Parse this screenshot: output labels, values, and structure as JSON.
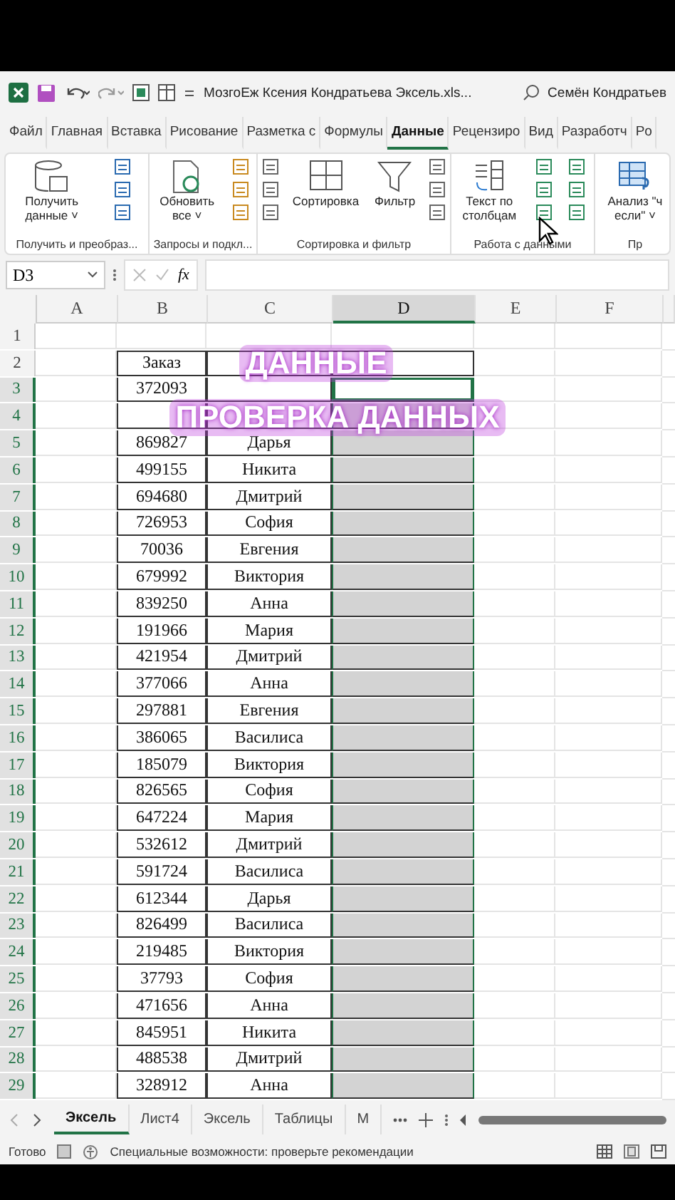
{
  "title_bar": {
    "title": "МозгоЕж Ксения Кондратьева Эксель.xls...",
    "user": "Семён Кондратьев"
  },
  "tabs": [
    {
      "label": "Файл",
      "selected": false
    },
    {
      "label": "Главная",
      "selected": false
    },
    {
      "label": "Вставка",
      "selected": false
    },
    {
      "label": "Рисование",
      "selected": false
    },
    {
      "label": "Разметка с",
      "selected": false
    },
    {
      "label": "Формулы",
      "selected": false
    },
    {
      "label": "Данные",
      "selected": true
    },
    {
      "label": "Рецензиро",
      "selected": false
    },
    {
      "label": "Вид",
      "selected": false
    },
    {
      "label": "Разработч",
      "selected": false
    },
    {
      "label": "Po",
      "selected": false
    }
  ],
  "ribbon_groups": [
    {
      "label": "Получить и преобраз...",
      "items": [
        {
          "kind": "large",
          "lines": [
            "Получить",
            "данные ˅"
          ]
        },
        {
          "kind": "small"
        }
      ]
    },
    {
      "label": "Запросы и подкл...",
      "items": [
        {
          "kind": "large",
          "lines": [
            "Обновить",
            "все ˅"
          ]
        },
        {
          "kind": "small"
        }
      ]
    },
    {
      "label": "Сортировка и фильтр",
      "items": [
        {
          "kind": "small"
        },
        {
          "kind": "large",
          "lines": [
            "Сортировка"
          ]
        },
        {
          "kind": "large",
          "lines": [
            "Фильтр"
          ]
        },
        {
          "kind": "small"
        }
      ]
    },
    {
      "label": "Работа с данными",
      "items": [
        {
          "kind": "large",
          "lines": [
            "Текст по",
            "столбцам"
          ]
        },
        {
          "kind": "small"
        },
        {
          "kind": "small"
        }
      ]
    },
    {
      "label": "Пр",
      "items": [
        {
          "kind": "large",
          "lines": [
            "Анализ \"ч",
            "если\" ˅"
          ]
        }
      ]
    }
  ],
  "formula_bar": {
    "name_box": "D3",
    "fx": "fx"
  },
  "columns": [
    {
      "label": "A",
      "selected": false
    },
    {
      "label": "B",
      "selected": false
    },
    {
      "label": "C",
      "selected": false
    },
    {
      "label": "D",
      "selected": true
    },
    {
      "label": "E",
      "selected": false
    },
    {
      "label": "F",
      "selected": false
    }
  ],
  "rows": [
    {
      "number": "1",
      "kind": "blank",
      "selected": false,
      "active": false
    },
    {
      "number": "2",
      "kind": "header",
      "selected": false,
      "active": false,
      "b": "Заказ"
    },
    {
      "number": "3",
      "kind": "data",
      "selected": true,
      "active": true,
      "b": "372093"
    },
    {
      "number": "4",
      "kind": "data",
      "selected": true,
      "active": false
    },
    {
      "number": "5",
      "kind": "data",
      "selected": true,
      "active": false,
      "b": "869827",
      "c": "Дарья"
    },
    {
      "number": "6",
      "kind": "data",
      "selected": true,
      "active": false,
      "b": "499155",
      "c": "Никита"
    },
    {
      "number": "7",
      "kind": "data",
      "selected": true,
      "active": false,
      "b": "694680",
      "c": "Дмитрий"
    },
    {
      "number": "8",
      "kind": "data",
      "selected": true,
      "active": false,
      "b": "726953",
      "c": "София"
    },
    {
      "number": "9",
      "kind": "data",
      "selected": true,
      "active": false,
      "b": "70036",
      "c": "Евгения"
    },
    {
      "number": "10",
      "kind": "data",
      "selected": true,
      "active": false,
      "b": "679992",
      "c": "Виктория"
    },
    {
      "number": "11",
      "kind": "data",
      "selected": true,
      "active": false,
      "b": "839250",
      "c": "Анна"
    },
    {
      "number": "12",
      "kind": "data",
      "selected": true,
      "active": false,
      "b": "191966",
      "c": "Мария"
    },
    {
      "number": "13",
      "kind": "data",
      "selected": true,
      "active": false,
      "b": "421954",
      "c": "Дмитрий"
    },
    {
      "number": "14",
      "kind": "data",
      "selected": true,
      "active": false,
      "b": "377066",
      "c": "Анна"
    },
    {
      "number": "15",
      "kind": "data",
      "selected": true,
      "active": false,
      "b": "297881",
      "c": "Евгения"
    },
    {
      "number": "16",
      "kind": "data",
      "selected": true,
      "active": false,
      "b": "386065",
      "c": "Василиса"
    },
    {
      "number": "17",
      "kind": "data",
      "selected": true,
      "active": false,
      "b": "185079",
      "c": "Виктория"
    },
    {
      "number": "18",
      "kind": "data",
      "selected": true,
      "active": false,
      "b": "826565",
      "c": "София"
    },
    {
      "number": "19",
      "kind": "data",
      "selected": true,
      "active": false,
      "b": "647224",
      "c": "Мария"
    },
    {
      "number": "20",
      "kind": "data",
      "selected": true,
      "active": false,
      "b": "532612",
      "c": "Дмитрий"
    },
    {
      "number": "21",
      "kind": "data",
      "selected": true,
      "active": false,
      "b": "591724",
      "c": "Василиса"
    },
    {
      "number": "22",
      "kind": "data",
      "selected": true,
      "active": false,
      "b": "612344",
      "c": "Дарья"
    },
    {
      "number": "23",
      "kind": "data",
      "selected": true,
      "active": false,
      "b": "826499",
      "c": "Василиса"
    },
    {
      "number": "24",
      "kind": "data",
      "selected": true,
      "active": false,
      "b": "219485",
      "c": "Виктория"
    },
    {
      "number": "25",
      "kind": "data",
      "selected": true,
      "active": false,
      "b": "37793",
      "c": "София"
    },
    {
      "number": "26",
      "kind": "data",
      "selected": true,
      "active": false,
      "b": "471656",
      "c": "Анна"
    },
    {
      "number": "27",
      "kind": "data",
      "selected": true,
      "active": false,
      "b": "845951",
      "c": "Никита"
    },
    {
      "number": "28",
      "kind": "data",
      "selected": true,
      "active": false,
      "b": "488538",
      "c": "Дмитрий"
    },
    {
      "number": "29",
      "kind": "data",
      "selected": true,
      "active": false,
      "b": "328912",
      "c": "Анна"
    }
  ],
  "overlay_caption": [
    "ДАННЫЕ",
    "ПРОВЕРКА ДАННЫХ"
  ],
  "sheet_tabs": [
    {
      "label": "Эксель",
      "selected": true
    },
    {
      "label": "Лист4",
      "selected": false
    },
    {
      "label": "Эксель",
      "selected": false
    },
    {
      "label": "Таблицы",
      "selected": false
    },
    {
      "label": "М",
      "selected": false
    }
  ],
  "status_bar": {
    "status": "Готово",
    "accessibility": "Специальные возможности: проверьте рекомендации"
  }
}
